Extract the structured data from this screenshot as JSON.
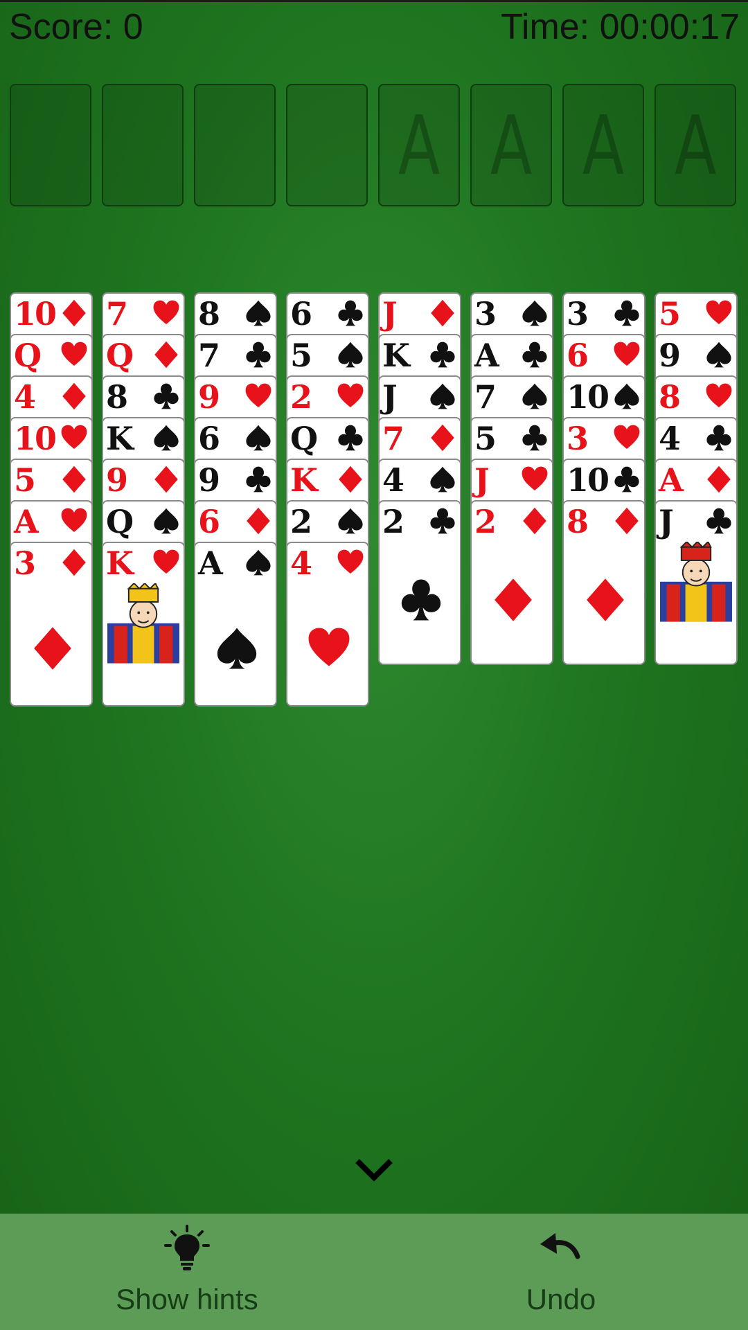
{
  "header": {
    "score_label": "Score: 0",
    "time_label": "Time: 00:00:17"
  },
  "free_cells": [
    {
      "label": ""
    },
    {
      "label": ""
    },
    {
      "label": ""
    },
    {
      "label": ""
    }
  ],
  "foundations": [
    {
      "label": "A"
    },
    {
      "label": "A"
    },
    {
      "label": "A"
    },
    {
      "label": "A"
    }
  ],
  "tableau": [
    [
      {
        "rank": "10",
        "suit": "diamond"
      },
      {
        "rank": "Q",
        "suit": "heart"
      },
      {
        "rank": "4",
        "suit": "diamond"
      },
      {
        "rank": "10",
        "suit": "heart"
      },
      {
        "rank": "5",
        "suit": "diamond"
      },
      {
        "rank": "A",
        "suit": "heart"
      },
      {
        "rank": "3",
        "suit": "diamond"
      }
    ],
    [
      {
        "rank": "7",
        "suit": "heart"
      },
      {
        "rank": "Q",
        "suit": "diamond"
      },
      {
        "rank": "8",
        "suit": "club"
      },
      {
        "rank": "K",
        "suit": "spade"
      },
      {
        "rank": "9",
        "suit": "diamond"
      },
      {
        "rank": "Q",
        "suit": "spade"
      },
      {
        "rank": "K",
        "suit": "heart"
      }
    ],
    [
      {
        "rank": "8",
        "suit": "spade"
      },
      {
        "rank": "7",
        "suit": "club"
      },
      {
        "rank": "9",
        "suit": "heart"
      },
      {
        "rank": "6",
        "suit": "spade"
      },
      {
        "rank": "9",
        "suit": "club"
      },
      {
        "rank": "6",
        "suit": "diamond"
      },
      {
        "rank": "A",
        "suit": "spade"
      }
    ],
    [
      {
        "rank": "6",
        "suit": "club"
      },
      {
        "rank": "5",
        "suit": "spade"
      },
      {
        "rank": "2",
        "suit": "heart"
      },
      {
        "rank": "Q",
        "suit": "club"
      },
      {
        "rank": "K",
        "suit": "diamond"
      },
      {
        "rank": "2",
        "suit": "spade"
      },
      {
        "rank": "4",
        "suit": "heart"
      }
    ],
    [
      {
        "rank": "J",
        "suit": "diamond"
      },
      {
        "rank": "K",
        "suit": "club"
      },
      {
        "rank": "J",
        "suit": "spade"
      },
      {
        "rank": "7",
        "suit": "diamond"
      },
      {
        "rank": "4",
        "suit": "spade"
      },
      {
        "rank": "2",
        "suit": "club"
      }
    ],
    [
      {
        "rank": "3",
        "suit": "spade"
      },
      {
        "rank": "A",
        "suit": "club"
      },
      {
        "rank": "7",
        "suit": "spade"
      },
      {
        "rank": "5",
        "suit": "club"
      },
      {
        "rank": "J",
        "suit": "heart"
      },
      {
        "rank": "2",
        "suit": "diamond"
      }
    ],
    [
      {
        "rank": "3",
        "suit": "club"
      },
      {
        "rank": "6",
        "suit": "heart"
      },
      {
        "rank": "10",
        "suit": "spade"
      },
      {
        "rank": "3",
        "suit": "heart"
      },
      {
        "rank": "10",
        "suit": "club"
      },
      {
        "rank": "8",
        "suit": "diamond"
      }
    ],
    [
      {
        "rank": "5",
        "suit": "heart"
      },
      {
        "rank": "9",
        "suit": "spade"
      },
      {
        "rank": "8",
        "suit": "heart"
      },
      {
        "rank": "4",
        "suit": "club"
      },
      {
        "rank": "A",
        "suit": "diamond"
      },
      {
        "rank": "J",
        "suit": "club"
      }
    ]
  ],
  "bottom_bar": {
    "hints_label": "Show hints",
    "hints_icon": "lightbulb-icon",
    "undo_label": "Undo",
    "undo_icon": "undo-arrow-icon"
  },
  "colors": {
    "red_suit": "#e8121a",
    "black_suit": "#111111",
    "felt": "#1f7520",
    "bottom_bar": "#5d9c57"
  }
}
